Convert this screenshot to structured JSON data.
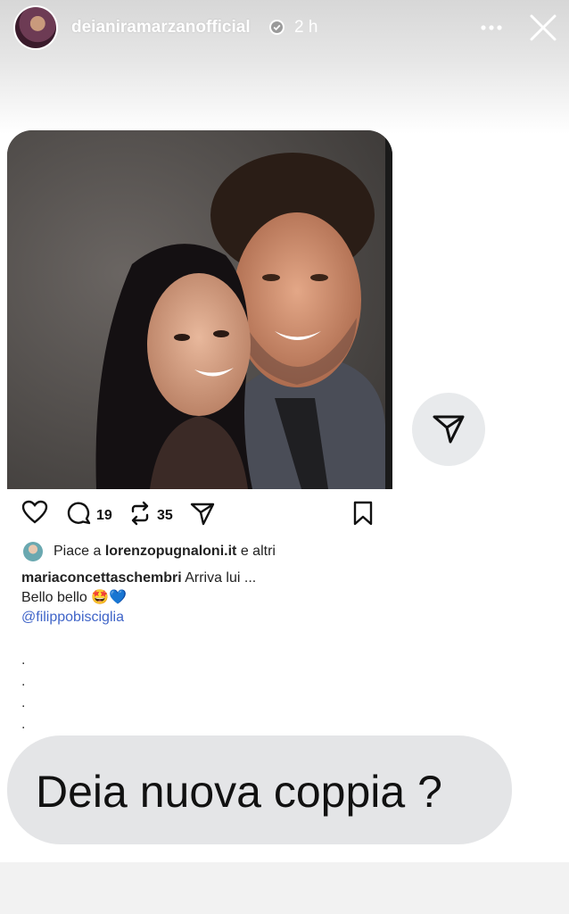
{
  "header": {
    "username": "deianiramarzanofficial",
    "time": "2 h"
  },
  "post": {
    "comments_count": "19",
    "reposts_count": "35",
    "likes_prefix": "Piace a",
    "likes_user": "lorenzopugnaloni.it",
    "likes_suffix": "e altri",
    "caption_user": "mariaconcettaschembri",
    "caption_text": "Arriva lui ...",
    "caption_line2": "Bello bello 🤩💙",
    "mention": "@filippobisciglia",
    "dots": [
      ".",
      ".",
      ".",
      "."
    ]
  },
  "sticker": {
    "text": "Deia nuova coppia ?"
  },
  "colors": {
    "mention": "#3f64c8",
    "bubble": "#e4e5e7",
    "share_circle": "#e8eaec"
  },
  "icons": [
    "more-icon",
    "close-icon",
    "verified-icon",
    "heart-icon",
    "comment-icon",
    "repost-icon",
    "send-icon",
    "bookmark-icon",
    "share-icon"
  ]
}
